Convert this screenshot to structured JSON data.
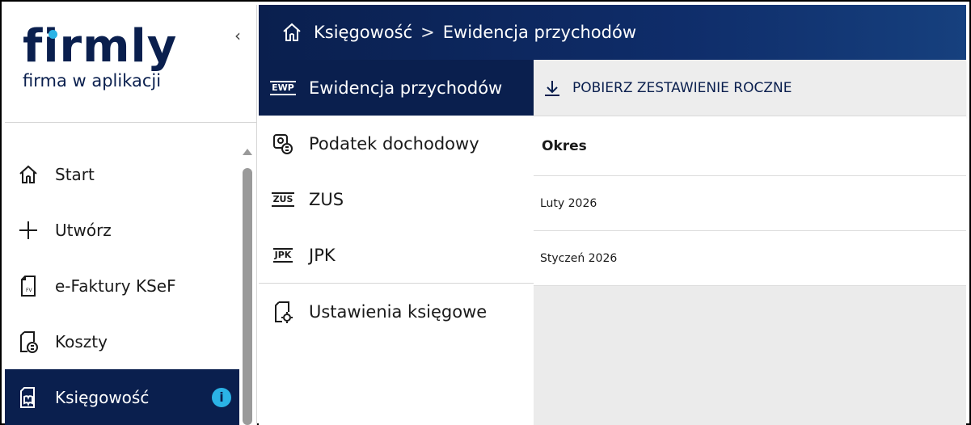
{
  "app": {
    "logo_text": "firmly",
    "logo_subtitle": "firma w aplikacji"
  },
  "colors": {
    "brand_navy": "#0a1f4e",
    "accent_cyan": "#2bb3e6"
  },
  "sidebar": {
    "items": [
      {
        "label": "Start",
        "icon": "home-icon"
      },
      {
        "label": "Utwórz",
        "icon": "plus-icon"
      },
      {
        "label": "e-Faktury KSeF",
        "icon": "invoice-fv-icon"
      },
      {
        "label": "Koszty",
        "icon": "costs-document-icon"
      },
      {
        "label": "Księgowość",
        "icon": "accounting-book-icon",
        "active": true,
        "badge": "i"
      }
    ]
  },
  "header": {
    "breadcrumb_root": "Księgowość",
    "breadcrumb_separator": ">",
    "breadcrumb_current": "Ewidencja przychodów"
  },
  "submenu": {
    "items": [
      {
        "tag": "EWP",
        "label": "Ewidencja przychodów",
        "active": true
      },
      {
        "icon": "income-tax-icon",
        "label": "Podatek dochodowy"
      },
      {
        "tag": "ZUS",
        "label": "ZUS"
      },
      {
        "tag": "JPK",
        "label": "JPK"
      },
      {
        "icon": "accounting-settings-icon",
        "label": "Ustawienia księgowe"
      }
    ]
  },
  "toolbar": {
    "download_label": "POBIERZ ZESTAWIENIE ROCZNE"
  },
  "table": {
    "header": "Okres",
    "rows": [
      "Luty 2026",
      "Styczeń 2026"
    ]
  }
}
